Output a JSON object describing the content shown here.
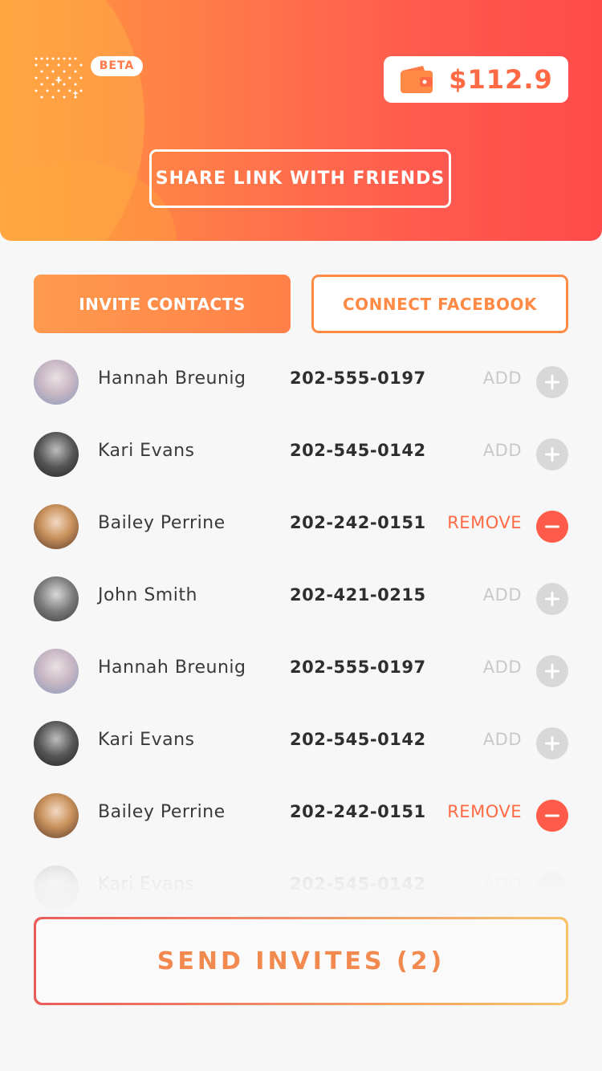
{
  "header": {
    "beta_label": "BETA",
    "balance": "$112.9",
    "share_button": "SHARE LINK WITH FRIENDS",
    "gradient_start": "#ff9b3e",
    "gradient_end": "#ff4a4a"
  },
  "tabs": {
    "invite_contacts": "INVITE CONTACTS",
    "connect_facebook": "CONNECT FACEBOOK"
  },
  "contacts": [
    {
      "name": "Hannah Breunig",
      "phone": "202-555-0197",
      "action": "ADD"
    },
    {
      "name": "Kari Evans",
      "phone": "202-545-0142",
      "action": "ADD"
    },
    {
      "name": "Bailey Perrine",
      "phone": "202-242-0151",
      "action": "REMOVE"
    },
    {
      "name": "John Smith",
      "phone": "202-421-0215",
      "action": "ADD"
    },
    {
      "name": "Hannah Breunig",
      "phone": "202-555-0197",
      "action": "ADD"
    },
    {
      "name": "Kari Evans",
      "phone": "202-545-0142",
      "action": "ADD"
    },
    {
      "name": "Bailey Perrine",
      "phone": "202-242-0151",
      "action": "REMOVE"
    },
    {
      "name": "Kari Evans",
      "phone": "202-545-0142",
      "action": "ADD"
    }
  ],
  "send_button": "SEND INVITES (2)",
  "colors": {
    "accent": "#ff8a45",
    "remove": "#ff5a4a",
    "add_inactive": "#d8d8d8"
  }
}
